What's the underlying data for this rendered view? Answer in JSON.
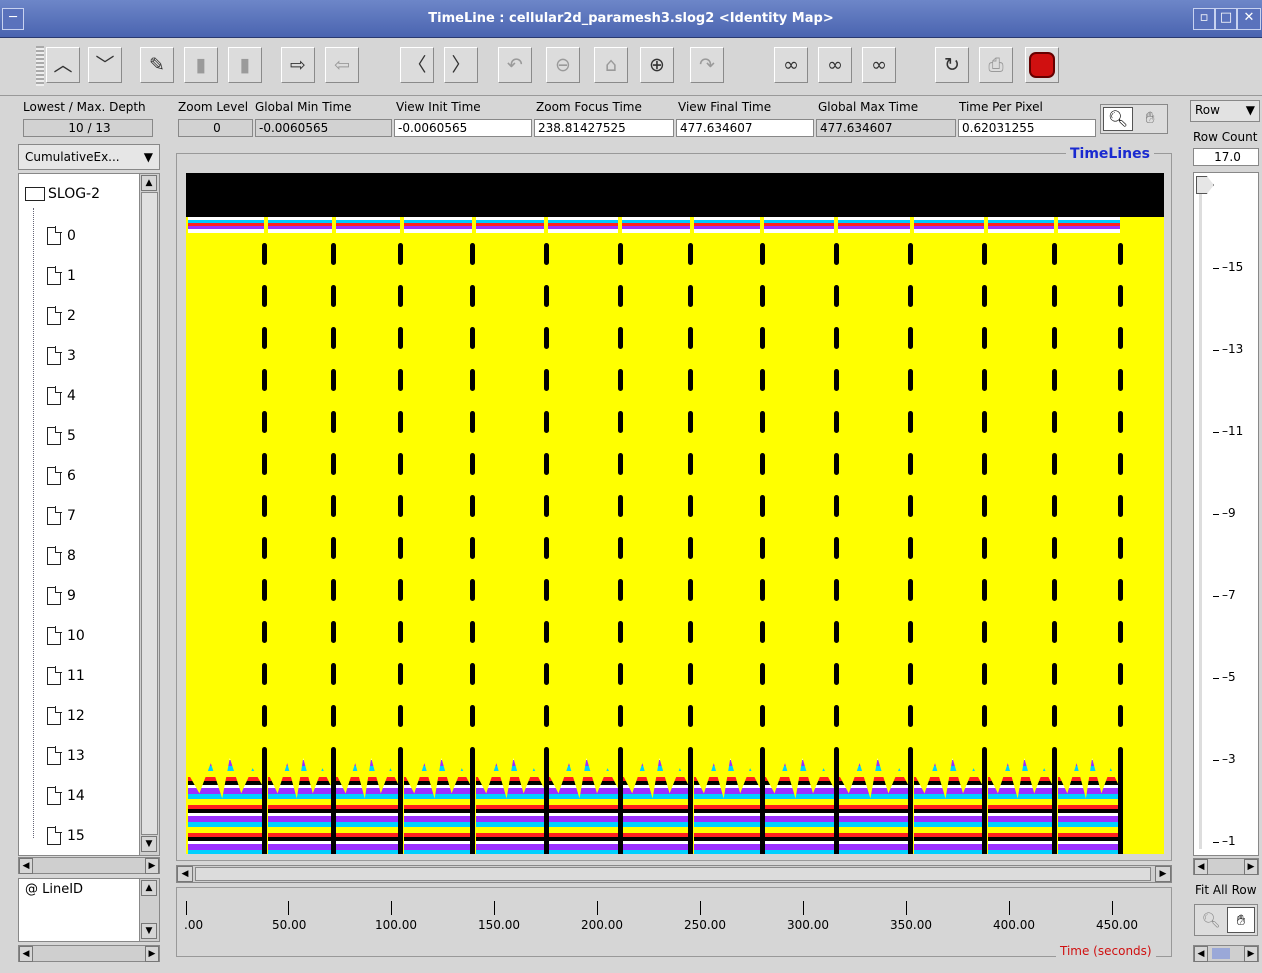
{
  "window": {
    "title": "TimeLine : cellular2d_paramesh3.slog2  <Identity Map>"
  },
  "header": {
    "depth_label": "Lowest / Max. Depth",
    "depth_value": "10 / 13",
    "zoom_label": "Zoom Level",
    "zoom_value": "0",
    "gmin_label": "Global Min Time",
    "gmin_value": "-0.0060565",
    "vinit_label": "View  Init Time",
    "vinit_value": "-0.0060565",
    "zfocus_label": "Zoom Focus Time",
    "zfocus_value": "238.81427525",
    "vfinal_label": "View Final Time",
    "vfinal_value": "477.634607",
    "gmax_label": "Global Max Time",
    "gmax_value": "477.634607",
    "tpp_label": "Time Per Pixel",
    "tpp_value": "0.62031255",
    "row_select": "Row",
    "rowcount_label": "Row Count",
    "rowcount_value": "17.0"
  },
  "left": {
    "dropdown": "CumulativeEx...",
    "root": "SLOG-2",
    "items": [
      "0",
      "1",
      "2",
      "3",
      "4",
      "5",
      "6",
      "7",
      "8",
      "9",
      "10",
      "11",
      "12",
      "13",
      "14",
      "15"
    ],
    "legend_item": "@ LineID"
  },
  "canvas": {
    "title": "TimeLines"
  },
  "axis": {
    "ticks": [
      ".00",
      "50.00",
      "100.00",
      "150.00",
      "200.00",
      "250.00",
      "300.00",
      "350.00",
      "400.00",
      "450.00"
    ],
    "label": "Time (seconds)"
  },
  "rightaxis": {
    "labels": [
      "–15",
      "–13",
      "–11",
      "–9",
      "–7",
      "–5",
      "–3",
      "–1"
    ],
    "fit_all": "Fit All Row"
  }
}
